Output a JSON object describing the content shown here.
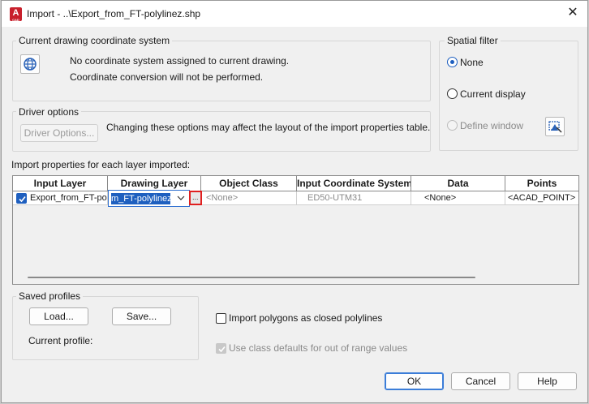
{
  "window": {
    "title": "Import - ..\\Export_from_FT-polylinez.shp",
    "app_icon_letter": "A",
    "app_icon_sub": "CAD"
  },
  "coordinate_system": {
    "group_label": "Current drawing coordinate system",
    "line1": "No coordinate system assigned to current drawing.",
    "line2": "Coordinate conversion will not be performed."
  },
  "spatial_filter": {
    "group_label": "Spatial filter",
    "options": [
      {
        "label": "None",
        "selected": true,
        "enabled": true
      },
      {
        "label": "Current display",
        "selected": false,
        "enabled": true
      },
      {
        "label": "Define window",
        "selected": false,
        "enabled": false
      }
    ]
  },
  "driver_options": {
    "group_label": "Driver options",
    "button_label": "Driver Options...",
    "note": "Changing these options may affect the layout of the import properties table."
  },
  "import_properties": {
    "label": "Import properties for each layer imported:",
    "columns": [
      "Input Layer",
      "Drawing Layer",
      "Object Class",
      "Input Coordinate System",
      "Data",
      "Points"
    ],
    "row": {
      "checked": true,
      "input_layer": "Export_from_FT-pol",
      "drawing_layer": "m_FT-polylinez",
      "object_class": "<None>",
      "input_cs": "ED50-UTM31",
      "data": "<None>",
      "points": "<ACAD_POINT>"
    },
    "ellipsis": "..."
  },
  "saved_profiles": {
    "group_label": "Saved profiles",
    "load_label": "Load...",
    "save_label": "Save...",
    "current_profile_label": "Current profile:"
  },
  "options": {
    "closed_polylines": {
      "label": "Import polygons as closed polylines",
      "checked": false
    },
    "class_defaults": {
      "label": "Use class defaults for out of range values",
      "checked": true,
      "enabled": false
    }
  },
  "buttons": {
    "ok": "OK",
    "cancel": "Cancel",
    "help": "Help"
  },
  "colors": {
    "accent": "#1e5fbf",
    "highlight_border": "#e02020",
    "app_red": "#c8202c"
  }
}
